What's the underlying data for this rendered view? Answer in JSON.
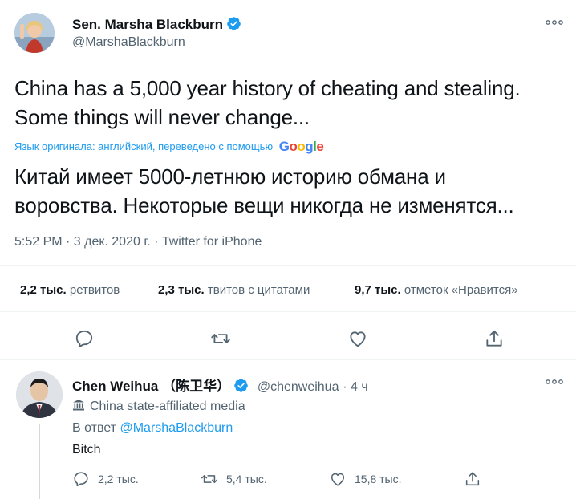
{
  "main_tweet": {
    "author_name": "Sen. Marsha Blackburn",
    "author_handle": "@MarshaBlackburn",
    "text_line1": "China has a 5,000 year history of cheating and stealing.",
    "text_line2": "Some things will never change...",
    "translation_note": "Язык оригинала: английский, переведено с помощью",
    "translation_provider": "Google",
    "translated_line1": "Китай имеет 5000-летнюю историю обмана и",
    "translated_line2": "воровства. Некоторые вещи никогда не изменятся...",
    "timestamp": "5:52 PM · 3 дек. 2020 г. · Twitter for iPhone",
    "stats": {
      "retweets_count": "2,2 тыс.",
      "retweets_label": "ретвитов",
      "quotes_count": "2,3 тыс.",
      "quotes_label": "твитов с цитатами",
      "likes_count": "9,7 тыс.",
      "likes_label": "отметок «Нравится»"
    }
  },
  "reply_tweet": {
    "author_name": "Chen Weihua （陈卫华）",
    "author_handle": "@chenweihua",
    "time_ago": "4 ч",
    "affiliation": "China state-affiliated media",
    "reply_prefix": "В ответ",
    "reply_to": "@MarshaBlackburn",
    "text": "Bitch",
    "stats": {
      "replies": "2,2 тыс.",
      "retweets": "5,4 тыс.",
      "likes": "15,8 тыс."
    }
  },
  "colors": {
    "accent": "#1d9bf0",
    "text_primary": "#0f1419",
    "text_secondary": "#536471",
    "divider": "#eff3f4"
  },
  "icons": [
    "reply-icon",
    "retweet-icon",
    "like-icon",
    "share-icon",
    "verified-icon",
    "more-icon",
    "building-icon"
  ]
}
